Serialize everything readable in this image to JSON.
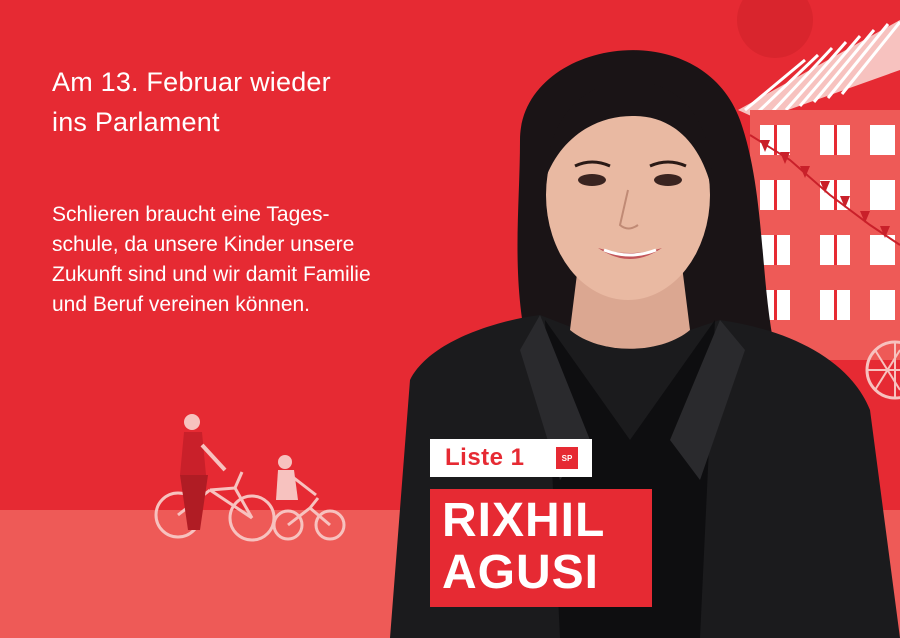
{
  "poster": {
    "headline_line1": "Am 13. Februar wieder",
    "headline_line2": "ins Parlament",
    "body_line1": "Schlieren braucht eine Tages-",
    "body_line2": "schule, da unsere Kinder unsere",
    "body_line3": "Zukunft sind und wir damit Familie",
    "body_line4": "und Beruf vereinen können.",
    "list_label": "Liste 1",
    "party_logo_text": "SP",
    "first_name": "RIXHIL",
    "last_name": "AGUSI"
  },
  "colors": {
    "brand_red": "#e62a33",
    "light_red": "#ee5a57",
    "pale_red": "#f48a85",
    "white": "#ffffff",
    "jacket": "#1b1b1d",
    "hair": "#1a1416",
    "skin": "#e9b9a2"
  },
  "icons": {
    "party_logo": "sp-logo-icon",
    "family_illustration": "bicycle-family-illustration",
    "building_illustration": "building-illustration",
    "portrait": "candidate-portrait"
  }
}
